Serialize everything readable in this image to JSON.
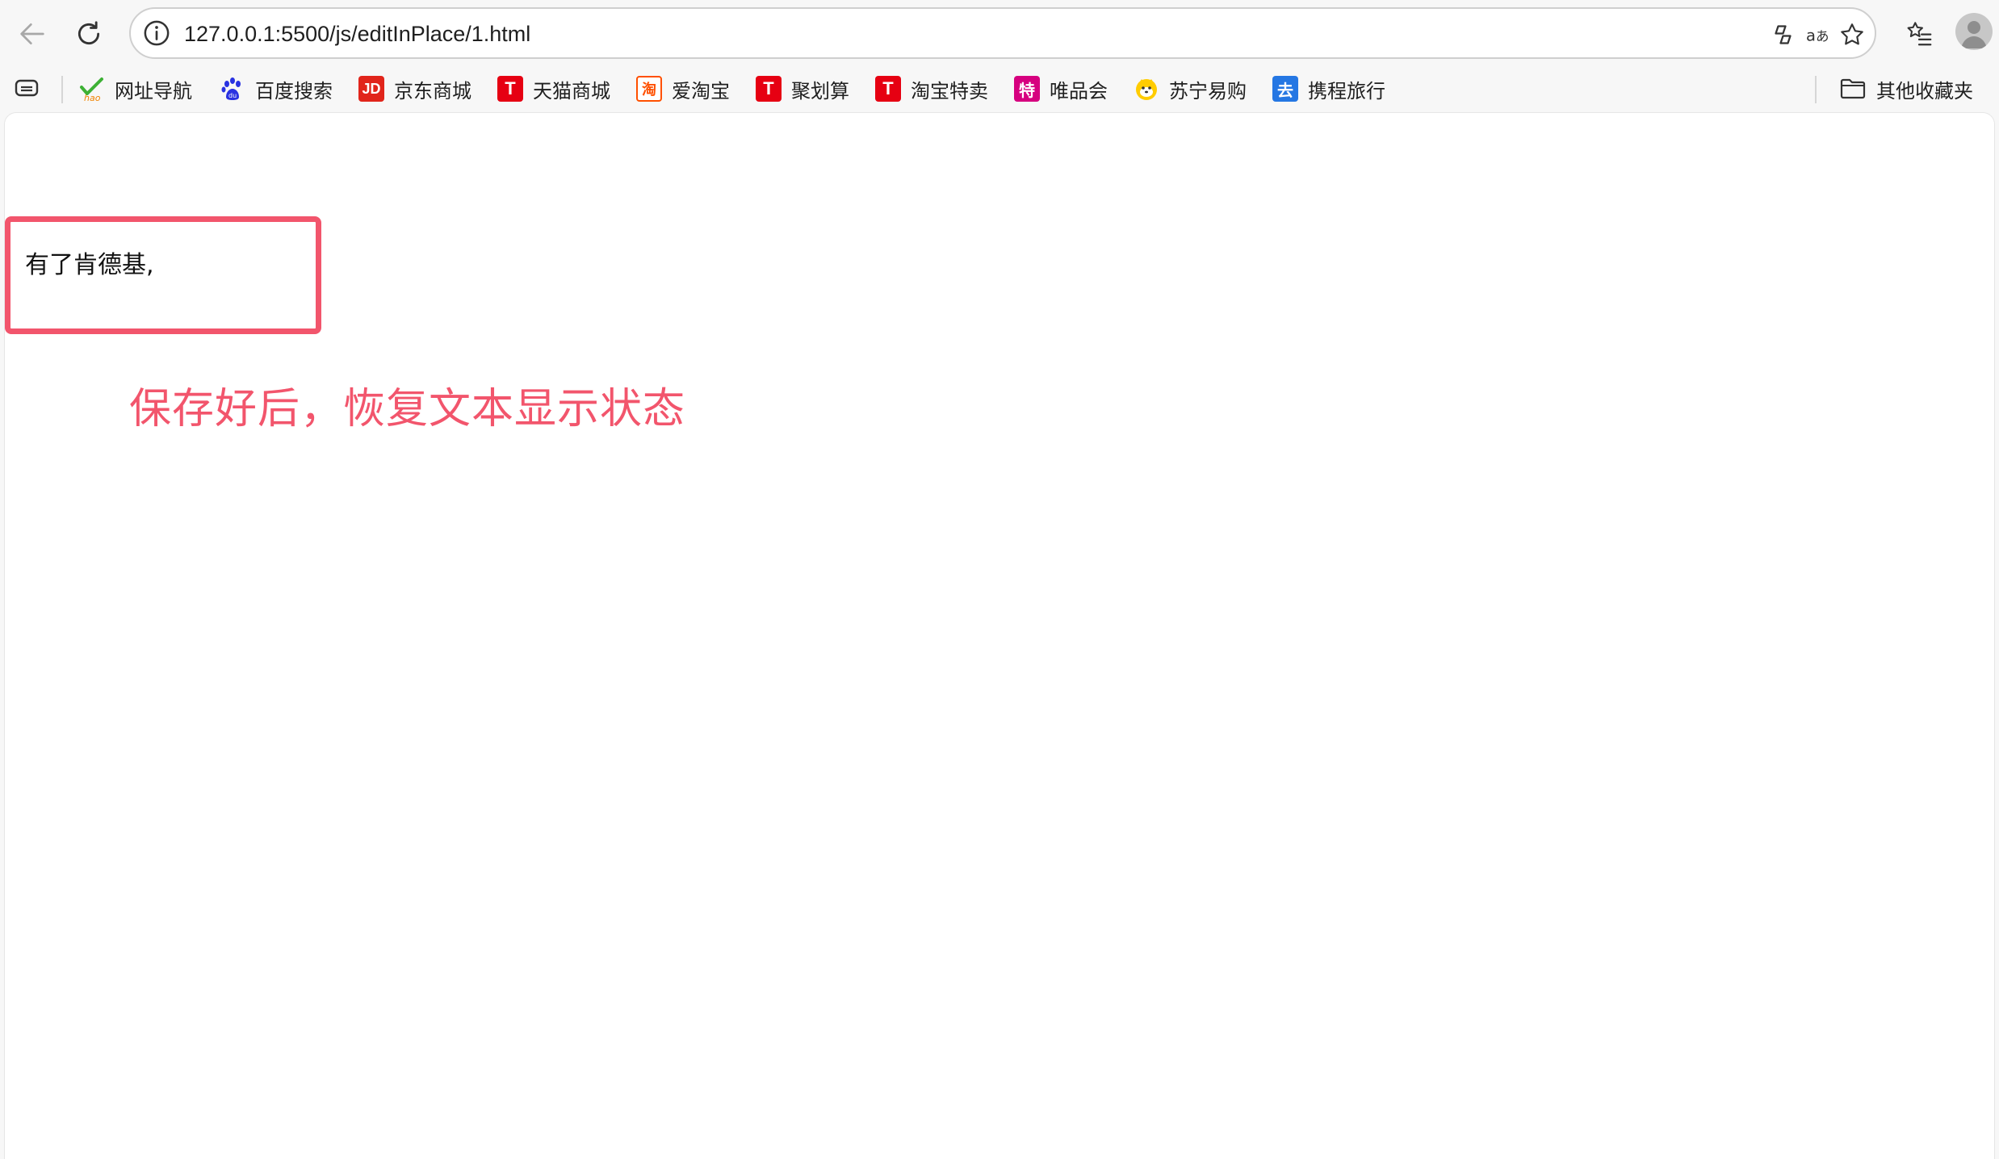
{
  "browser": {
    "url": "127.0.0.1:5500/js/editInPlace/1.html",
    "accent_color": "#f2556c",
    "icons": {
      "back": "arrow-left-icon",
      "reload": "reload-icon",
      "site_info": "info-icon",
      "copilot": "copilot-icon",
      "translate": "translate-icon",
      "favorite": "star-icon",
      "favorites_bar": "favorites-icon",
      "profile": "profile-avatar-icon"
    }
  },
  "bookmarks": {
    "items": [
      {
        "label": "网址导航",
        "icon": "hao-nav-icon",
        "color": "#3db135"
      },
      {
        "label": "百度搜索",
        "icon": "baidu-paw-icon",
        "color": "#2932e1"
      },
      {
        "label": "京东商城",
        "icon": "jd-icon",
        "color": "#e1251b",
        "glyph": "JD"
      },
      {
        "label": "天猫商城",
        "icon": "tmall-icon",
        "color": "#e60012",
        "glyph": "T"
      },
      {
        "label": "爱淘宝",
        "icon": "taobao-icon",
        "color": "#ff5000",
        "glyph": "淘"
      },
      {
        "label": "聚划算",
        "icon": "juhuasuan-icon",
        "color": "#e60012",
        "glyph": "T"
      },
      {
        "label": "淘宝特卖",
        "icon": "taobao-temai-icon",
        "color": "#e60012",
        "glyph": "T"
      },
      {
        "label": "唯品会",
        "icon": "vip-icon",
        "color": "#d6007f",
        "glyph": "特"
      },
      {
        "label": "苏宁易购",
        "icon": "suning-icon",
        "color": "#ffcc00"
      },
      {
        "label": "携程旅行",
        "icon": "ctrip-icon",
        "color": "#2577e3",
        "glyph": "去"
      }
    ],
    "other_folder": "其他收藏夹"
  },
  "page": {
    "editable_text": "有了肯德基,",
    "annotation": "保存好后，恢复文本显示状态"
  }
}
